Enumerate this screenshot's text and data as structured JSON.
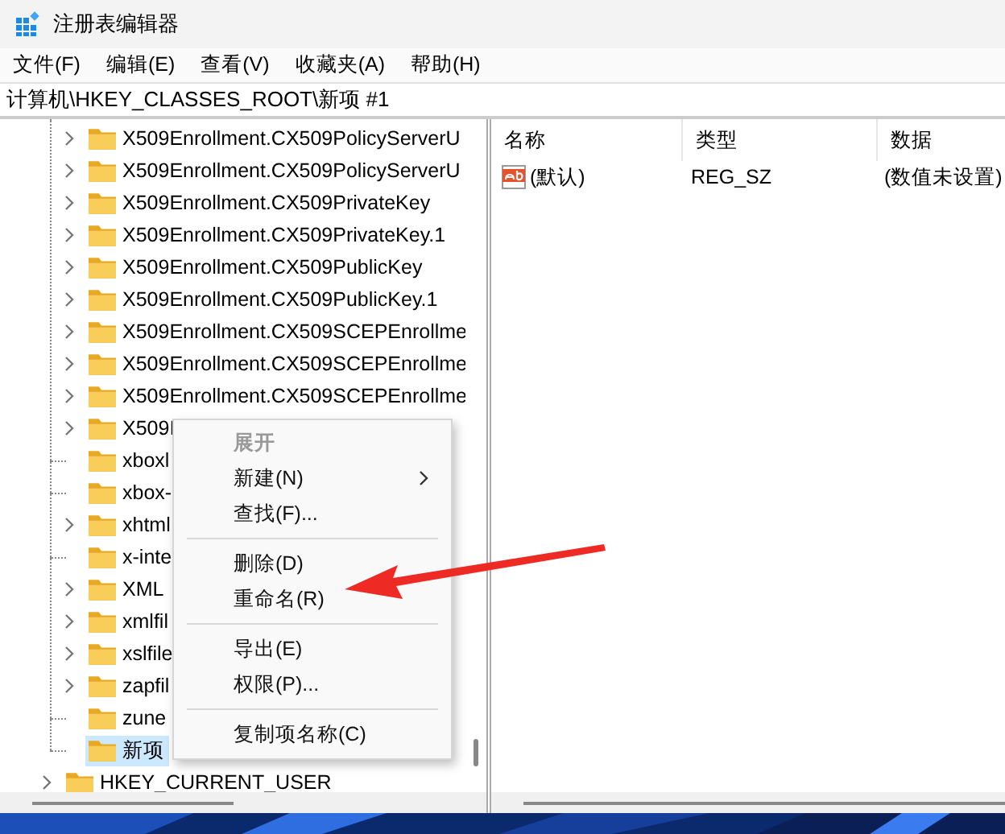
{
  "window": {
    "title": "注册表编辑器"
  },
  "menu_bar": [
    "文件(F)",
    "编辑(E)",
    "查看(V)",
    "收藏夹(A)",
    "帮助(H)"
  ],
  "address_bar": {
    "value": "计算机\\HKEY_CLASSES_ROOT\\新项 #1"
  },
  "tree": {
    "children": [
      {
        "label": "X509Enrollment.CX509PolicyServerU",
        "expandable": true,
        "selected": false
      },
      {
        "label": "X509Enrollment.CX509PolicyServerU",
        "expandable": true,
        "selected": false
      },
      {
        "label": "X509Enrollment.CX509PrivateKey",
        "expandable": true,
        "selected": false
      },
      {
        "label": "X509Enrollment.CX509PrivateKey.1",
        "expandable": true,
        "selected": false
      },
      {
        "label": "X509Enrollment.CX509PublicKey",
        "expandable": true,
        "selected": false
      },
      {
        "label": "X509Enrollment.CX509PublicKey.1",
        "expandable": true,
        "selected": false
      },
      {
        "label": "X509Enrollment.CX509SCEPEnrollme",
        "expandable": true,
        "selected": false
      },
      {
        "label": "X509Enrollment.CX509SCEPEnrollme",
        "expandable": true,
        "selected": false
      },
      {
        "label": "X509Enrollment.CX509SCEPEnrollme",
        "expandable": true,
        "selected": false
      },
      {
        "label": "X509I",
        "expandable": true,
        "selected": false
      },
      {
        "label": "xboxl",
        "expandable": false,
        "selected": false
      },
      {
        "label": "xbox-",
        "expandable": false,
        "selected": false
      },
      {
        "label": "xhtml",
        "expandable": true,
        "selected": false
      },
      {
        "label": "x-inte",
        "expandable": false,
        "selected": false
      },
      {
        "label": "XML",
        "expandable": true,
        "selected": false
      },
      {
        "label": "xmlfil",
        "expandable": true,
        "selected": false
      },
      {
        "label": "xslfile",
        "expandable": true,
        "selected": false
      },
      {
        "label": "zapfil",
        "expandable": true,
        "selected": false
      },
      {
        "label": "zune",
        "expandable": false,
        "selected": false
      },
      {
        "label": "新项",
        "expandable": false,
        "selected": true
      }
    ],
    "siblings": [
      {
        "label": "HKEY_CURRENT_USER",
        "expandable": true,
        "selected": false
      }
    ]
  },
  "values_table": {
    "columns": [
      "名称",
      "类型",
      "数据"
    ],
    "rows": [
      {
        "name": "(默认)",
        "type": "REG_SZ",
        "data": "(数值未设置)"
      }
    ]
  },
  "context_menu": [
    {
      "kind": "item",
      "label": "展开",
      "disabled": true,
      "bold": true,
      "submenu": false
    },
    {
      "kind": "item",
      "label": "新建(N)",
      "disabled": false,
      "bold": false,
      "submenu": true
    },
    {
      "kind": "item",
      "label": "查找(F)...",
      "disabled": false,
      "bold": false,
      "submenu": false
    },
    {
      "kind": "separator"
    },
    {
      "kind": "item",
      "label": "删除(D)",
      "disabled": false,
      "bold": false,
      "submenu": false
    },
    {
      "kind": "item",
      "label": "重命名(R)",
      "disabled": false,
      "bold": false,
      "submenu": false
    },
    {
      "kind": "separator"
    },
    {
      "kind": "item",
      "label": "导出(E)",
      "disabled": false,
      "bold": false,
      "submenu": false
    },
    {
      "kind": "item",
      "label": "权限(P)...",
      "disabled": false,
      "bold": false,
      "submenu": false
    },
    {
      "kind": "separator"
    },
    {
      "kind": "item",
      "label": "复制项名称(C)",
      "disabled": false,
      "bold": false,
      "submenu": false
    }
  ]
}
